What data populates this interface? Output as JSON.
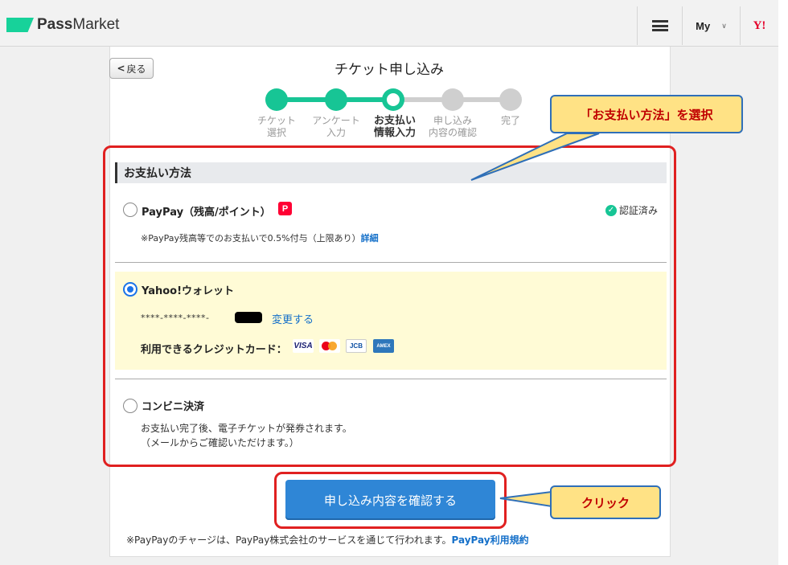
{
  "header": {
    "logo_bold": "Pass",
    "logo_rest": "Market",
    "my_label": "My",
    "yahoo_label": "Y!"
  },
  "nav": {
    "back_label": "戻る",
    "page_title": "チケット申し込み"
  },
  "steps": [
    {
      "line1": "チケット",
      "line2": "選択",
      "state": "done"
    },
    {
      "line1": "アンケート",
      "line2": "入力",
      "state": "done"
    },
    {
      "line1": "お支払い",
      "line2": "情報入力",
      "state": "current"
    },
    {
      "line1": "申し込み",
      "line2": "内容の確認",
      "state": "todo"
    },
    {
      "line1": "完了",
      "line2": "",
      "state": "todo"
    }
  ],
  "annotations": {
    "callout_select": "「お支払い方法」を選択",
    "callout_click": "クリック"
  },
  "payment": {
    "section_title": "お支払い方法",
    "options": [
      {
        "label": "PayPay（残高/ポイント）",
        "selected": false,
        "verified_text": "認証済み",
        "note": "※PayPay残高等でのお支払いで0.5%付与（上限あり）",
        "note_link": "詳細"
      },
      {
        "label": "Yahoo!ウォレット",
        "selected": true,
        "card_number": "****-****-****-",
        "change_link": "変更する",
        "cards_label": "利用できるクレジットカード：",
        "card_brands": [
          "VISA",
          "Mastercard",
          "JCB",
          "AMEX"
        ]
      },
      {
        "label": "コンビニ決済",
        "selected": false,
        "desc_line1": "お支払い完了後、電子チケットが発券されます。",
        "desc_line2": "（メールからご確認いただけます。）"
      }
    ]
  },
  "submit_label": "申し込み内容を確認する",
  "footnote": {
    "text": "※PayPayのチャージは、PayPay株式会社のサービスを通じて行われます。",
    "link": "PayPay利用規約"
  },
  "colors": {
    "accent_green": "#17c595",
    "submit_blue": "#2f86d6",
    "link_blue": "#1570c9",
    "highlight_red": "#e02020",
    "callout_yellow": "#ffe285"
  }
}
